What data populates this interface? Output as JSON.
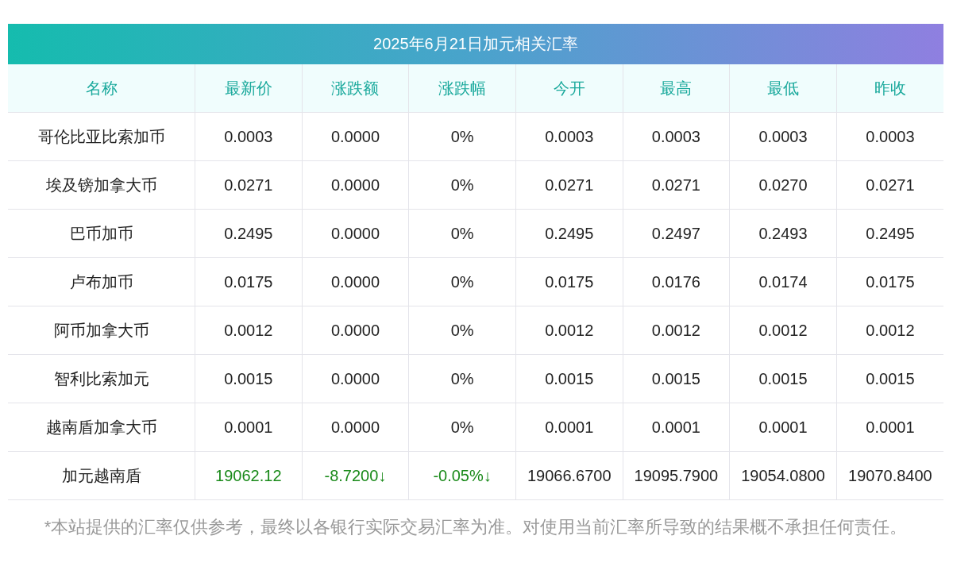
{
  "title": "2025年6月21日加元相关汇率",
  "columns": [
    "名称",
    "最新价",
    "涨跌额",
    "涨跌幅",
    "今开",
    "最高",
    "最低",
    "昨收"
  ],
  "rows": [
    {
      "cells": [
        "哥伦比亚比索加币",
        "0.0003",
        "0.0000",
        "0%",
        "0.0003",
        "0.0003",
        "0.0003",
        "0.0003"
      ],
      "falling": false
    },
    {
      "cells": [
        "埃及镑加拿大币",
        "0.0271",
        "0.0000",
        "0%",
        "0.0271",
        "0.0271",
        "0.0270",
        "0.0271"
      ],
      "falling": false
    },
    {
      "cells": [
        "巴币加币",
        "0.2495",
        "0.0000",
        "0%",
        "0.2495",
        "0.2497",
        "0.2493",
        "0.2495"
      ],
      "falling": false
    },
    {
      "cells": [
        "卢布加币",
        "0.0175",
        "0.0000",
        "0%",
        "0.0175",
        "0.0176",
        "0.0174",
        "0.0175"
      ],
      "falling": false
    },
    {
      "cells": [
        "阿币加拿大币",
        "0.0012",
        "0.0000",
        "0%",
        "0.0012",
        "0.0012",
        "0.0012",
        "0.0012"
      ],
      "falling": false
    },
    {
      "cells": [
        "智利比索加元",
        "0.0015",
        "0.0000",
        "0%",
        "0.0015",
        "0.0015",
        "0.0015",
        "0.0015"
      ],
      "falling": false
    },
    {
      "cells": [
        "越南盾加拿大币",
        "0.0001",
        "0.0000",
        "0%",
        "0.0001",
        "0.0001",
        "0.0001",
        "0.0001"
      ],
      "falling": false
    },
    {
      "cells": [
        "加元越南盾",
        "19062.12",
        "-8.7200↓",
        "-0.05%↓",
        "19066.6700",
        "19095.7900",
        "19054.0800",
        "19070.8400"
      ],
      "falling": true
    }
  ],
  "note": "*本站提供的汇率仅供参考，最终以各银行实际交易汇率为准。对使用当前汇率所导致的结果概不承担任何责任。"
}
